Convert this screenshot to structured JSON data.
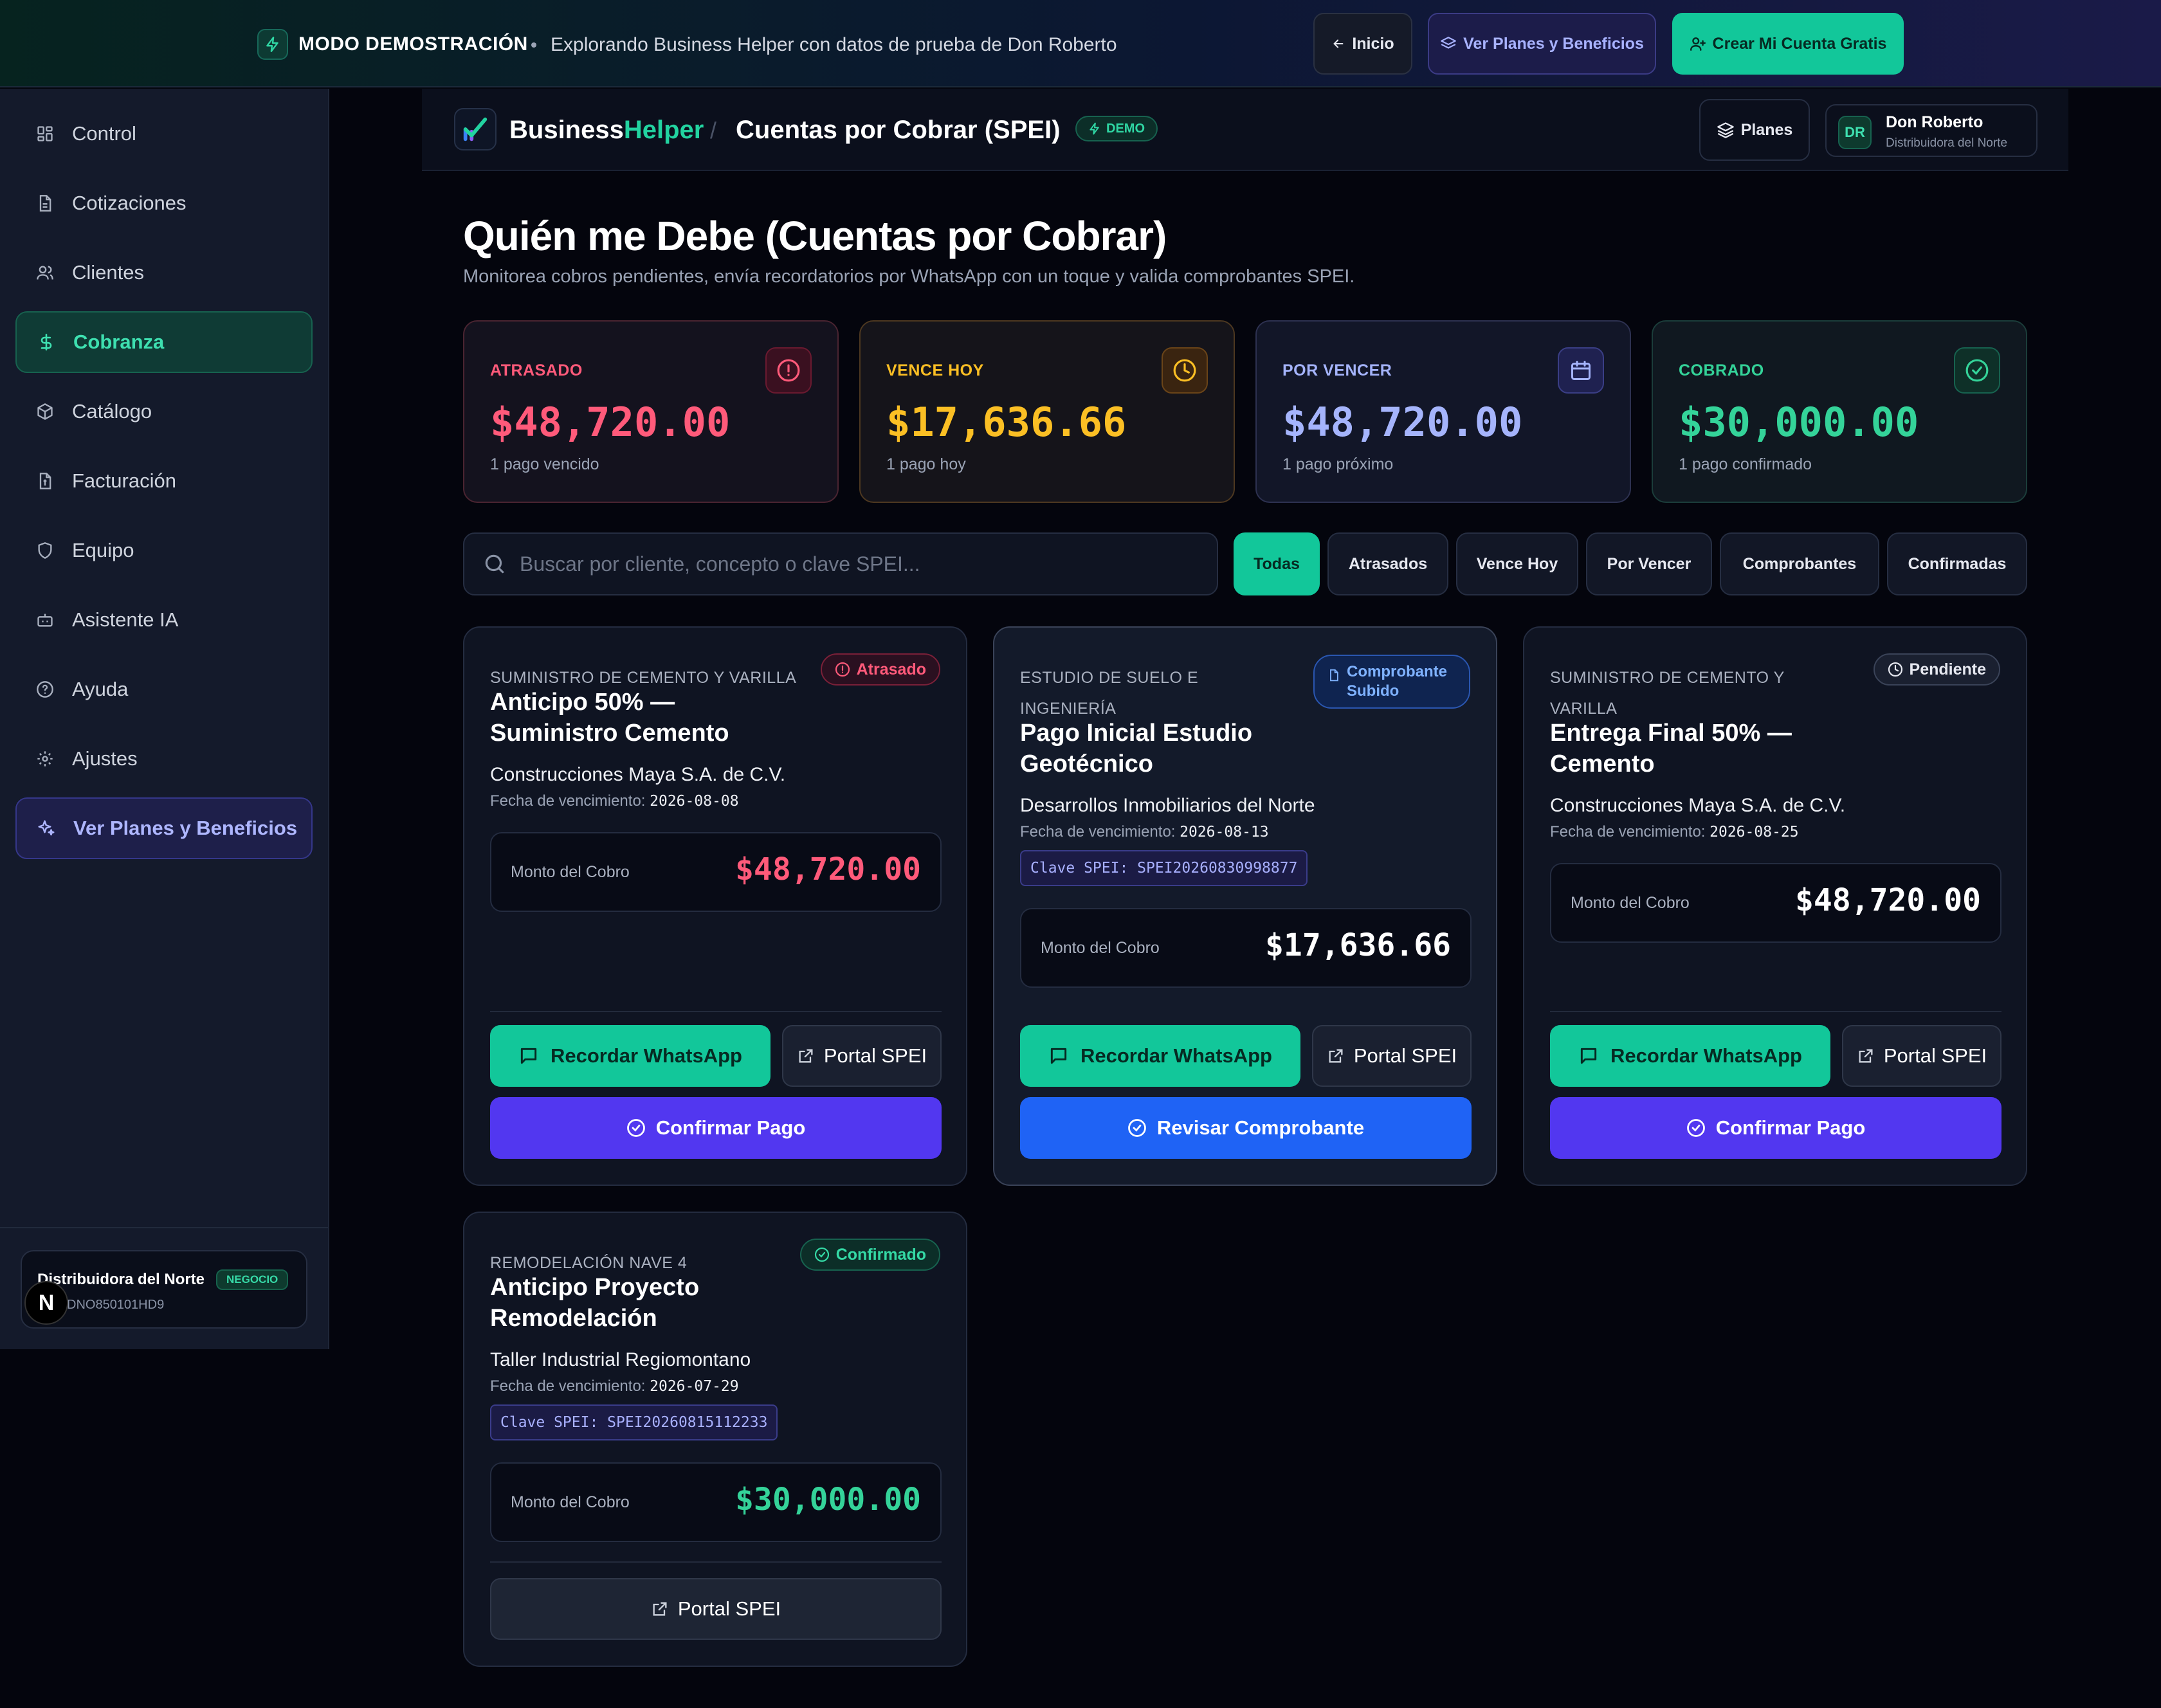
{
  "banner": {
    "mode": "MODO DEMOSTRACIÓN",
    "text": "Explorando Business Helper con datos de prueba de Don Roberto",
    "inicio": "Inicio",
    "planes": "Ver Planes y Beneficios",
    "crear": "Crear Mi Cuenta Gratis"
  },
  "sidebar": {
    "items": [
      {
        "label": "Control",
        "icon": "grid-icon"
      },
      {
        "label": "Cotizaciones",
        "icon": "document-icon"
      },
      {
        "label": "Clientes",
        "icon": "users-icon"
      },
      {
        "label": "Cobranza",
        "icon": "dollar-icon",
        "active": true
      },
      {
        "label": "Catálogo",
        "icon": "box-icon"
      },
      {
        "label": "Facturación",
        "icon": "invoice-icon"
      },
      {
        "label": "Equipo",
        "icon": "shield-icon"
      },
      {
        "label": "Asistente IA",
        "icon": "bot-icon"
      },
      {
        "label": "Ayuda",
        "icon": "help-icon"
      },
      {
        "label": "Ajustes",
        "icon": "gear-icon"
      }
    ],
    "promo": "Ver Planes y Beneficios",
    "company": {
      "name": "Distribuidora del Norte",
      "rfc": "DNO850101HD9",
      "badge": "NEGOCIO"
    },
    "avatar_letter": "N"
  },
  "header": {
    "brand_a": "Business",
    "brand_b": "Helper",
    "separator": "/",
    "title": "Cuentas por Cobrar (SPEI)",
    "demo": "DEMO",
    "planes": "Planes",
    "user": {
      "initials": "DR",
      "name": "Don Roberto",
      "company": "Distribuidora del Norte"
    }
  },
  "page": {
    "title": "Quién me Debe (Cuentas por Cobrar)",
    "subtitle": "Monitorea cobros pendientes, envía recordatorios por WhatsApp con un toque y valida comprobantes SPEI."
  },
  "stats": [
    {
      "label": "ATRASADO",
      "amount": "$48,720.00",
      "desc": "1 pago vencido",
      "color": "#ff5a7a",
      "icon": "alert-circle-icon"
    },
    {
      "label": "VENCE HOY",
      "amount": "$17,636.66",
      "desc": "1 pago hoy",
      "color": "#fbbf24",
      "icon": "clock-icon"
    },
    {
      "label": "POR VENCER",
      "amount": "$48,720.00",
      "desc": "1 pago próximo",
      "color": "#a5b4fc",
      "icon": "calendar-icon"
    },
    {
      "label": "COBRADO",
      "amount": "$30,000.00",
      "desc": "1 pago confirmado",
      "color": "#34d399",
      "icon": "check-circle-icon"
    }
  ],
  "search": {
    "placeholder": "Buscar por cliente, concepto o clave SPEI..."
  },
  "filters": [
    "Todas",
    "Atrasados",
    "Vence Hoy",
    "Por Vencer",
    "Comprobantes",
    "Confirmadas"
  ],
  "common": {
    "amount_label": "Monto del Cobro",
    "due_label": "Fecha de vencimiento:",
    "remind": "Recordar WhatsApp",
    "portal": "Portal SPEI",
    "confirm": "Confirmar Pago",
    "review": "Revisar Comprobante"
  },
  "cards": [
    {
      "category": "SUMINISTRO DE CEMENTO Y VARILLA",
      "title": "Anticipo 50% — Suministro Cemento",
      "client": "Construcciones Maya S.A. de C.V.",
      "due": "2026-08-08",
      "amount": "$48,720.00",
      "status": "Atrasado",
      "amount_color": "#ff5a7a"
    },
    {
      "category": "ESTUDIO DE SUELO E INGENIERÍA",
      "title": "Pago Inicial Estudio Geotécnico",
      "client": "Desarrollos Inmobiliarios del Norte",
      "due": "2026-08-13",
      "spei": "Clave SPEI: SPEI20260830998877",
      "amount": "$17,636.66",
      "status": "Comprobante Subido",
      "amount_color": "#ffffff"
    },
    {
      "category": "SUMINISTRO DE CEMENTO Y VARILLA",
      "title": "Entrega Final 50% — Cemento",
      "client": "Construcciones Maya S.A. de C.V.",
      "due": "2026-08-25",
      "amount": "$48,720.00",
      "status": "Pendiente",
      "amount_color": "#ffffff"
    },
    {
      "category": "REMODELACIÓN NAVE 4",
      "title": "Anticipo Proyecto Remodelación",
      "client": "Taller Industrial Regiomontano",
      "due": "2026-07-29",
      "spei": "Clave SPEI: SPEI20260815112233",
      "amount": "$30,000.00",
      "status": "Confirmado",
      "amount_color": "#34d399"
    }
  ]
}
